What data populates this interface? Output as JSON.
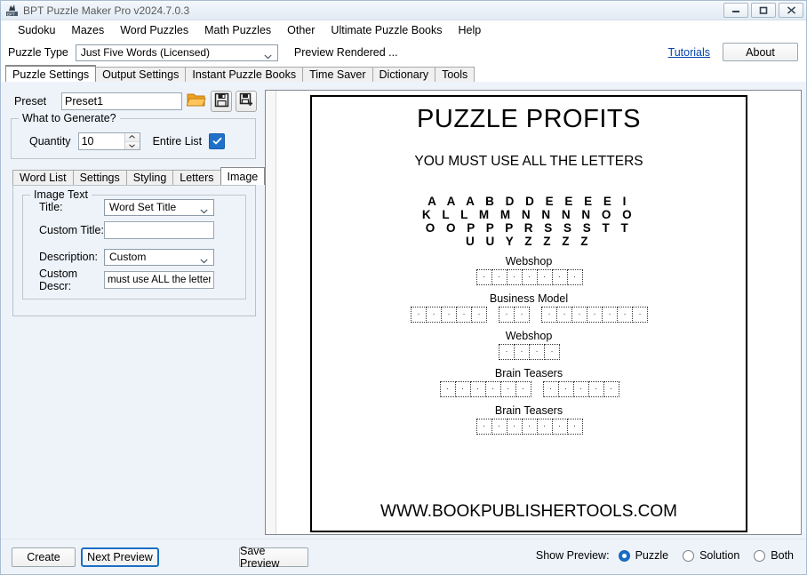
{
  "window": {
    "title": "BPT Puzzle Maker Pro v2024.7.0.3",
    "icon": "app-icon",
    "controls": {
      "minimize": "minimize-icon",
      "maximize": "maximize-icon",
      "close": "close-icon"
    }
  },
  "menubar": {
    "items": [
      {
        "label": "Sudoku"
      },
      {
        "label": "Mazes"
      },
      {
        "label": "Word Puzzles"
      },
      {
        "label": "Math Puzzles"
      },
      {
        "label": "Other"
      },
      {
        "label": "Ultimate Puzzle Books"
      },
      {
        "label": "Help"
      }
    ]
  },
  "toolbar": {
    "puzzle_type_label": "Puzzle Type",
    "puzzle_type_value": "Just Five Words (Licensed)",
    "preview_rendered": "Preview Rendered ...",
    "tutorials_link": "Tutorials",
    "about_button": "About"
  },
  "main_tabs": [
    {
      "label": "Puzzle Settings",
      "active": true
    },
    {
      "label": "Output Settings",
      "active": false
    },
    {
      "label": "Instant Puzzle Books",
      "active": false
    },
    {
      "label": "Time Saver",
      "active": false
    },
    {
      "label": "Dictionary",
      "active": false
    },
    {
      "label": "Tools",
      "active": false
    }
  ],
  "preset": {
    "label": "Preset",
    "value": "Preset1",
    "open_icon": "folder-open-icon",
    "save_icon": "save-icon",
    "save_as_icon": "save-as-icon"
  },
  "what_to_generate": {
    "title": "What to Generate?",
    "quantity_label": "Quantity",
    "quantity_value": "10",
    "entire_list_label": "Entire List",
    "entire_list_checked": true
  },
  "inner_tabs": [
    {
      "label": "Word List",
      "active": false
    },
    {
      "label": "Settings",
      "active": false
    },
    {
      "label": "Styling",
      "active": false
    },
    {
      "label": "Letters",
      "active": false
    },
    {
      "label": "Image",
      "active": true
    }
  ],
  "image_text": {
    "group_title": "Image Text",
    "title_label": "Title:",
    "title_value": "Word Set Title",
    "custom_title_label": "Custom Title:",
    "custom_title_value": "",
    "custom_title_placeholder": "",
    "description_label": "Description:",
    "description_value": "Custom",
    "custom_descr_label": "Custom Descr:",
    "custom_descr_value": "must use ALL the letters"
  },
  "preview": {
    "title": "PUZZLE PROFITS",
    "subtitle": "YOU MUST USE ALL THE LETTERS",
    "letter_rows": [
      "A A A B D D E E E E I",
      "K L L M M N N N N O O",
      "O O P P P R S S S T T",
      "U U Y Z Z Z Z"
    ],
    "answers": [
      {
        "label": "Webshop",
        "words": [
          7
        ]
      },
      {
        "label": "Business Model",
        "words": [
          5,
          2,
          7
        ]
      },
      {
        "label": "Webshop",
        "words": [
          4
        ]
      },
      {
        "label": "Brain Teasers",
        "words": [
          6,
          5
        ]
      },
      {
        "label": "Brain Teasers",
        "words": [
          7
        ]
      }
    ],
    "url": "WWW.BOOKPUBLISHERTOOLS.COM"
  },
  "bottom": {
    "create_label": "Create",
    "next_preview_label": "Next Preview",
    "save_preview_label": "Save Preview",
    "show_preview_label": "Show Preview:",
    "radios": [
      {
        "label": "Puzzle",
        "checked": true
      },
      {
        "label": "Solution",
        "checked": false
      },
      {
        "label": "Both",
        "checked": false
      }
    ]
  },
  "colors": {
    "accent": "#1a6fc4",
    "link": "#0645ad",
    "folder": "#f0a11e"
  }
}
